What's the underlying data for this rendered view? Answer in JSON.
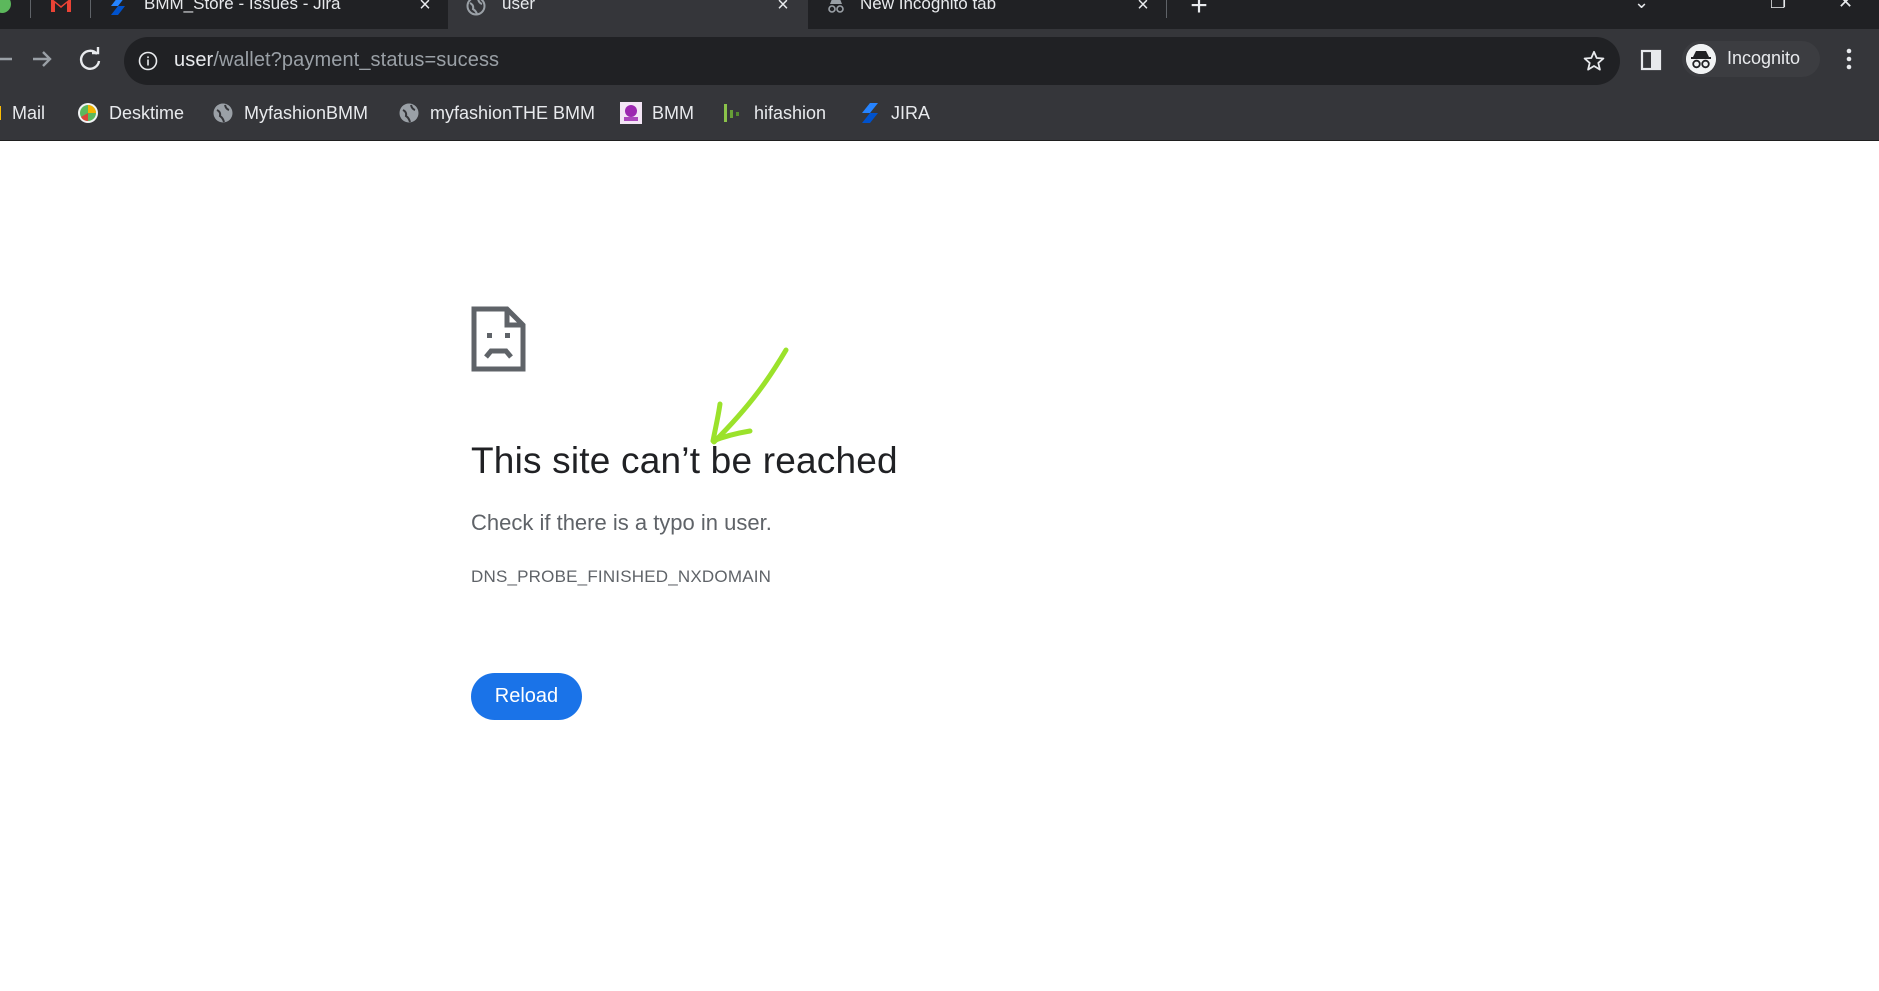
{
  "tabs": [
    {
      "title": "BMM_Store - Issues - Jira",
      "favicon": "jira-icon"
    },
    {
      "title": "user",
      "favicon": "globe-icon",
      "active": true
    },
    {
      "title": "New Incognito tab",
      "favicon": "incognito-icon"
    }
  ],
  "toolbar": {
    "url_host": "user",
    "url_path": "/wallet?payment_status=sucess",
    "profile_label": "Incognito"
  },
  "bookmarks": [
    {
      "label": "Mail",
      "icon": "gmail-icon",
      "color": "#ea4335"
    },
    {
      "label": "Desktime",
      "icon": "desktime-icon",
      "color": "#5cb85c"
    },
    {
      "label": "MyfashionBMM",
      "icon": "globe-icon",
      "color": "#9aa0a6"
    },
    {
      "label": "myfashionTHE BMM",
      "icon": "globe-icon",
      "color": "#9aa0a6"
    },
    {
      "label": "BMM",
      "icon": "bmm-icon",
      "color": "#9c27b0"
    },
    {
      "label": "hifashion",
      "icon": "hifashion-icon",
      "color": "#8bc34a"
    },
    {
      "label": "JIRA",
      "icon": "jira-icon",
      "color": "#2684ff"
    }
  ],
  "error_page": {
    "title": "This site can’t be reached",
    "subtitle": "Check if there is a typo in user.",
    "error_code": "DNS_PROBE_FINISHED_NXDOMAIN",
    "reload_label": "Reload"
  },
  "colors": {
    "accent": "#1a73e8",
    "annotation": "#9be22b",
    "chrome_dark": "#202124",
    "chrome_toolbar": "#35363a"
  }
}
